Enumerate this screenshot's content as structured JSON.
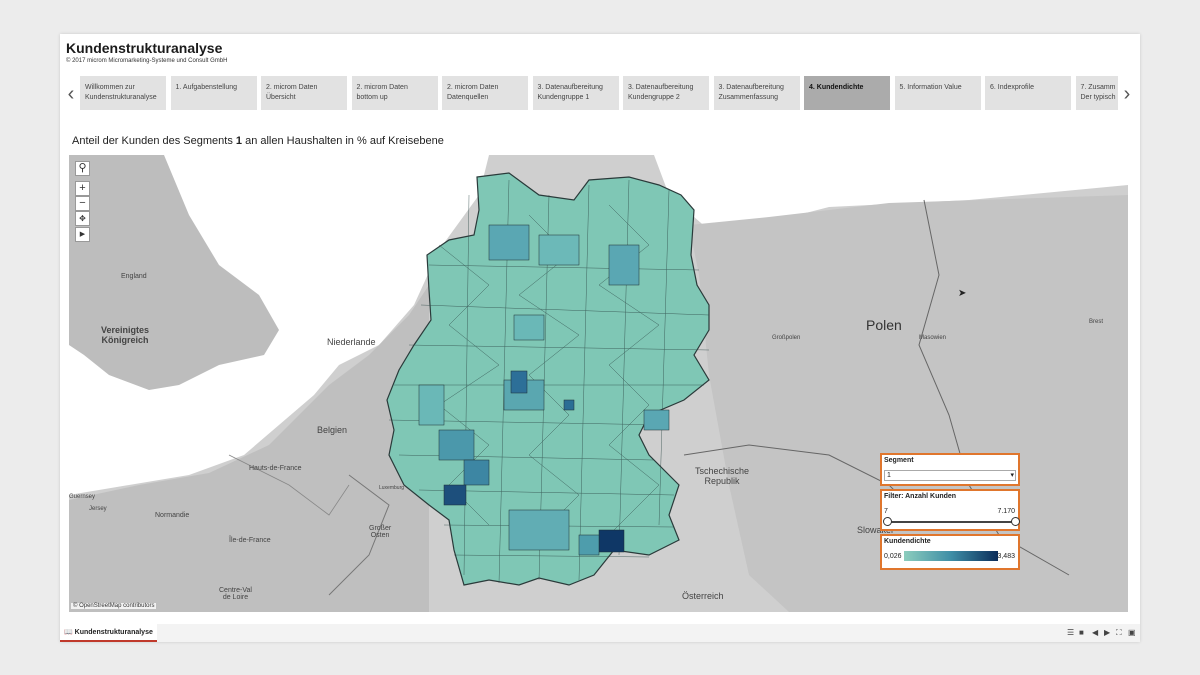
{
  "app": {
    "title": "Kundenstrukturanalyse",
    "subtitle": "© 2017 microm Micromarketing-Systeme und Consult GmbH"
  },
  "story_tabs": [
    {
      "label": "Willkommen zur\nKundenstrukturanalyse",
      "active": false
    },
    {
      "label": "1. Aufgabenstellung",
      "active": false
    },
    {
      "label": "2. microm Daten\nÜbersicht",
      "active": false
    },
    {
      "label": "2. microm Daten\nbottom up",
      "active": false
    },
    {
      "label": "2. microm Daten\nDatenquellen",
      "active": false
    },
    {
      "label": "3. Datenaufbereitung\nKundengruppe 1",
      "active": false
    },
    {
      "label": "3. Datenaufbereitung\nKundengruppe 2",
      "active": false
    },
    {
      "label": "3. Datenaufbereitung\nZusammenfassung",
      "active": false
    },
    {
      "label": "4. Kundendichte",
      "active": true
    },
    {
      "label": "5. Information Value",
      "active": false
    },
    {
      "label": "6. Indexprofile",
      "active": false
    },
    {
      "label": "7. Zusamm\nDer typisch",
      "active": false
    }
  ],
  "nav": {
    "prev_icon": "chevron-left-icon",
    "next_icon": "chevron-right-icon"
  },
  "caption": {
    "prefix": "Anteil der Kunden des Segments ",
    "segment": "1",
    "suffix": " an allen Haushalten in % auf Kreisebene"
  },
  "map": {
    "labels": [
      {
        "text": "England",
        "size": "small"
      },
      {
        "text": "Vereinigtes\nKönigreich",
        "size": "medium"
      },
      {
        "text": "Niederlande",
        "size": "medium"
      },
      {
        "text": "Belgien",
        "size": "medium"
      },
      {
        "text": "Luxemburg",
        "size": "tiny"
      },
      {
        "text": "Hauts-de-France",
        "size": "small"
      },
      {
        "text": "Normandie",
        "size": "small"
      },
      {
        "text": "Île-de-France",
        "size": "small"
      },
      {
        "text": "Großer\nOsten",
        "size": "small"
      },
      {
        "text": "Centre-Val\nde Loire",
        "size": "small"
      },
      {
        "text": "Guernsey",
        "size": "tiny"
      },
      {
        "text": "Jersey",
        "size": "tiny"
      },
      {
        "text": "Polen",
        "size": "large"
      },
      {
        "text": "Großpolen",
        "size": "tiny"
      },
      {
        "text": "Masowien",
        "size": "tiny"
      },
      {
        "text": "Brest",
        "size": "tiny"
      },
      {
        "text": "Tschechische\nRepublik",
        "size": "medium"
      },
      {
        "text": "Slowakei",
        "size": "medium"
      },
      {
        "text": "Österreich",
        "size": "medium"
      }
    ],
    "credit": "© OpenStreetMap contributors",
    "controls": [
      "search-icon",
      "zoom-in-icon",
      "zoom-out-icon",
      "pan-icon",
      "play-icon"
    ],
    "colors": {
      "low": "#8ccdbd",
      "mid": "#3f8ea6",
      "high": "#0b2d5a",
      "land": "#dcdcdc",
      "sea": "#ffffff"
    }
  },
  "filters": {
    "segment": {
      "title": "Segment",
      "value": "1"
    },
    "anzahl": {
      "title": "Filter: Anzahl Kunden",
      "min": "7",
      "max": "7.170"
    },
    "legend": {
      "title": "Kundendichte",
      "min": "0,026",
      "max": "3,483"
    }
  },
  "bottom": {
    "sheet_label": "Kundenstrukturanalyse",
    "sheet_icon": "book-icon"
  }
}
